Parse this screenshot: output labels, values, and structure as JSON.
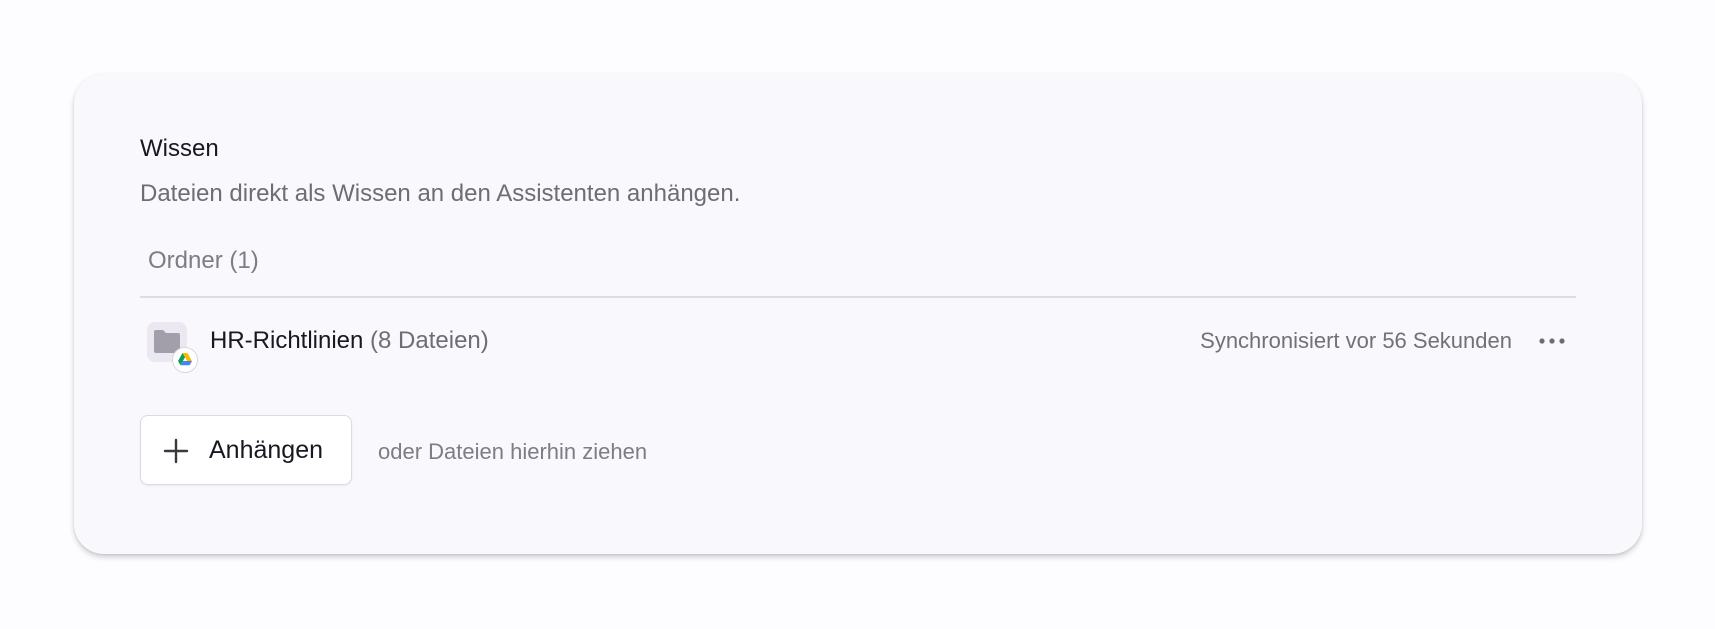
{
  "knowledge": {
    "title": "Wissen",
    "description": "Dateien direkt als Wissen an den Assistenten anhängen.",
    "section_label": "Ordner (1)",
    "folders": [
      {
        "name": "HR-Richtlinien",
        "file_count": "(8 Dateien)",
        "sync_status": "Synchronisiert vor 56 Sekunden",
        "icon": "folder-icon",
        "source_icon": "google-drive-icon"
      }
    ],
    "attach_button": {
      "icon": "plus-icon",
      "label": "Anhängen"
    },
    "drop_hint": "oder Dateien hierhin ziehen"
  },
  "colors": {
    "card_background": "#f9f8fc",
    "primary_text": "#19171f",
    "secondary_text": "#6f6c75",
    "folder_icon": "#a29fab"
  }
}
